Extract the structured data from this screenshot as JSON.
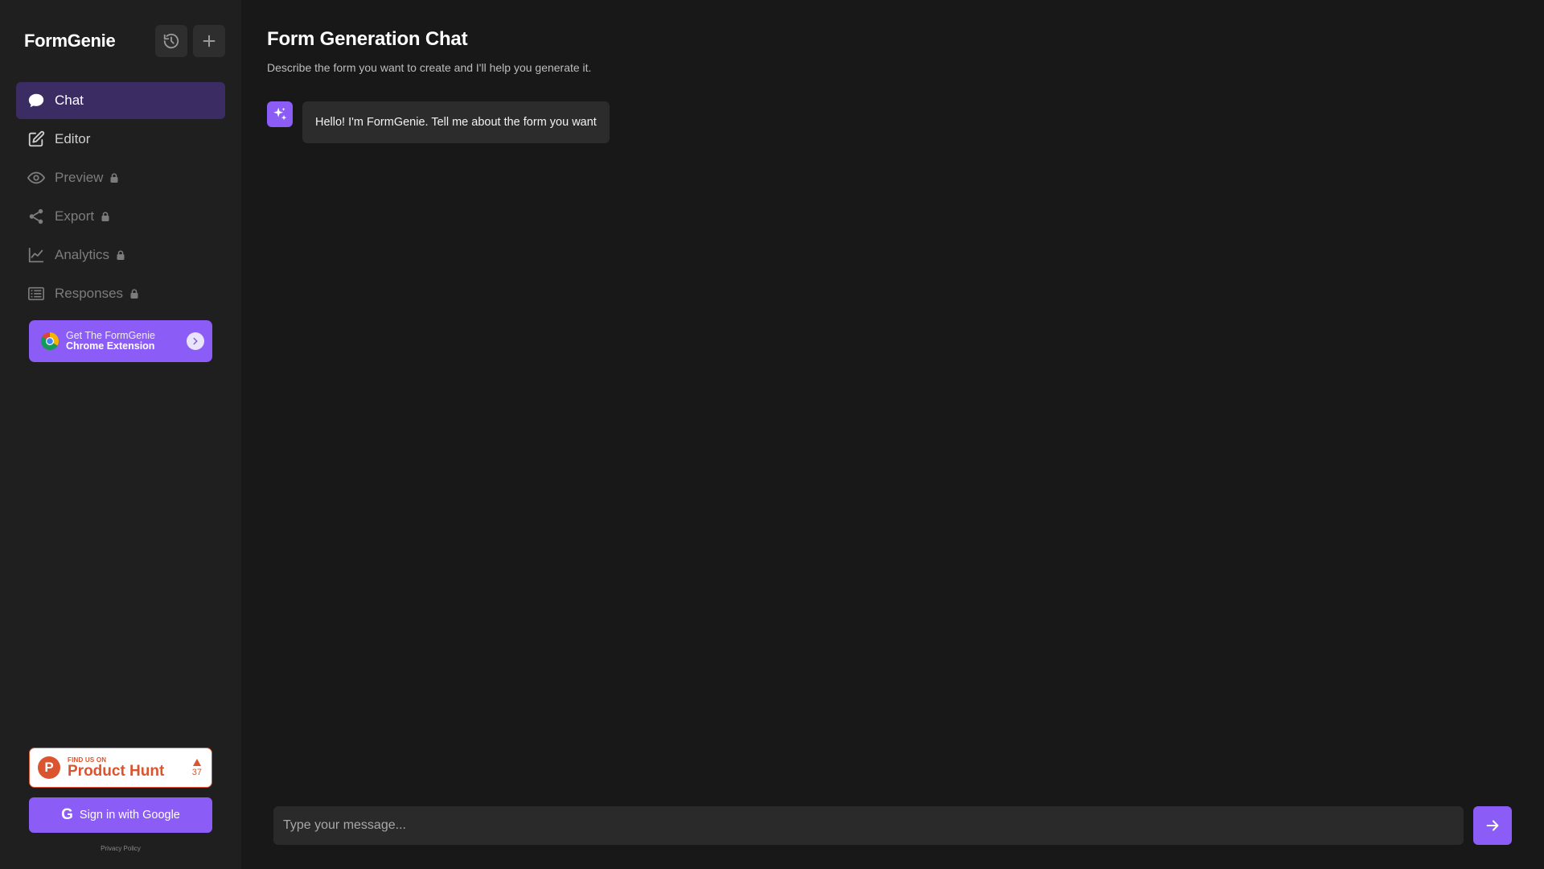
{
  "app": {
    "name": "FormGenie"
  },
  "header_buttons": {
    "history_icon": "history-icon",
    "new_icon": "plus-icon"
  },
  "nav": [
    {
      "label": "Chat",
      "icon": "chat-bubble-icon",
      "active": true,
      "locked": false
    },
    {
      "label": "Editor",
      "icon": "edit-icon",
      "active": false,
      "locked": false
    },
    {
      "label": "Preview",
      "icon": "eye-icon",
      "active": false,
      "locked": true
    },
    {
      "label": "Export",
      "icon": "share-icon",
      "active": false,
      "locked": true
    },
    {
      "label": "Analytics",
      "icon": "chart-line-icon",
      "active": false,
      "locked": true
    },
    {
      "label": "Responses",
      "icon": "list-icon",
      "active": false,
      "locked": true
    }
  ],
  "extension_banner": {
    "line1": "Get The FormGenie",
    "line2": "Chrome Extension"
  },
  "product_hunt": {
    "small": "FIND US ON",
    "big": "Product Hunt",
    "votes": "37",
    "logo_letter": "P"
  },
  "sign_in": {
    "label": "Sign in with Google",
    "icon_letter": "G"
  },
  "privacy": "Privacy Policy",
  "main": {
    "title": "Form Generation Chat",
    "subtitle": "Describe the form you want to create and I'll help you generate it.",
    "messages": [
      {
        "role": "assistant",
        "text": "Hello! I'm FormGenie. Tell me about the form you want"
      }
    ]
  },
  "composer": {
    "placeholder": "Type your message..."
  },
  "colors": {
    "accent": "#8b5cf6",
    "active_nav": "#3b2d64",
    "product_hunt": "#da552f"
  }
}
